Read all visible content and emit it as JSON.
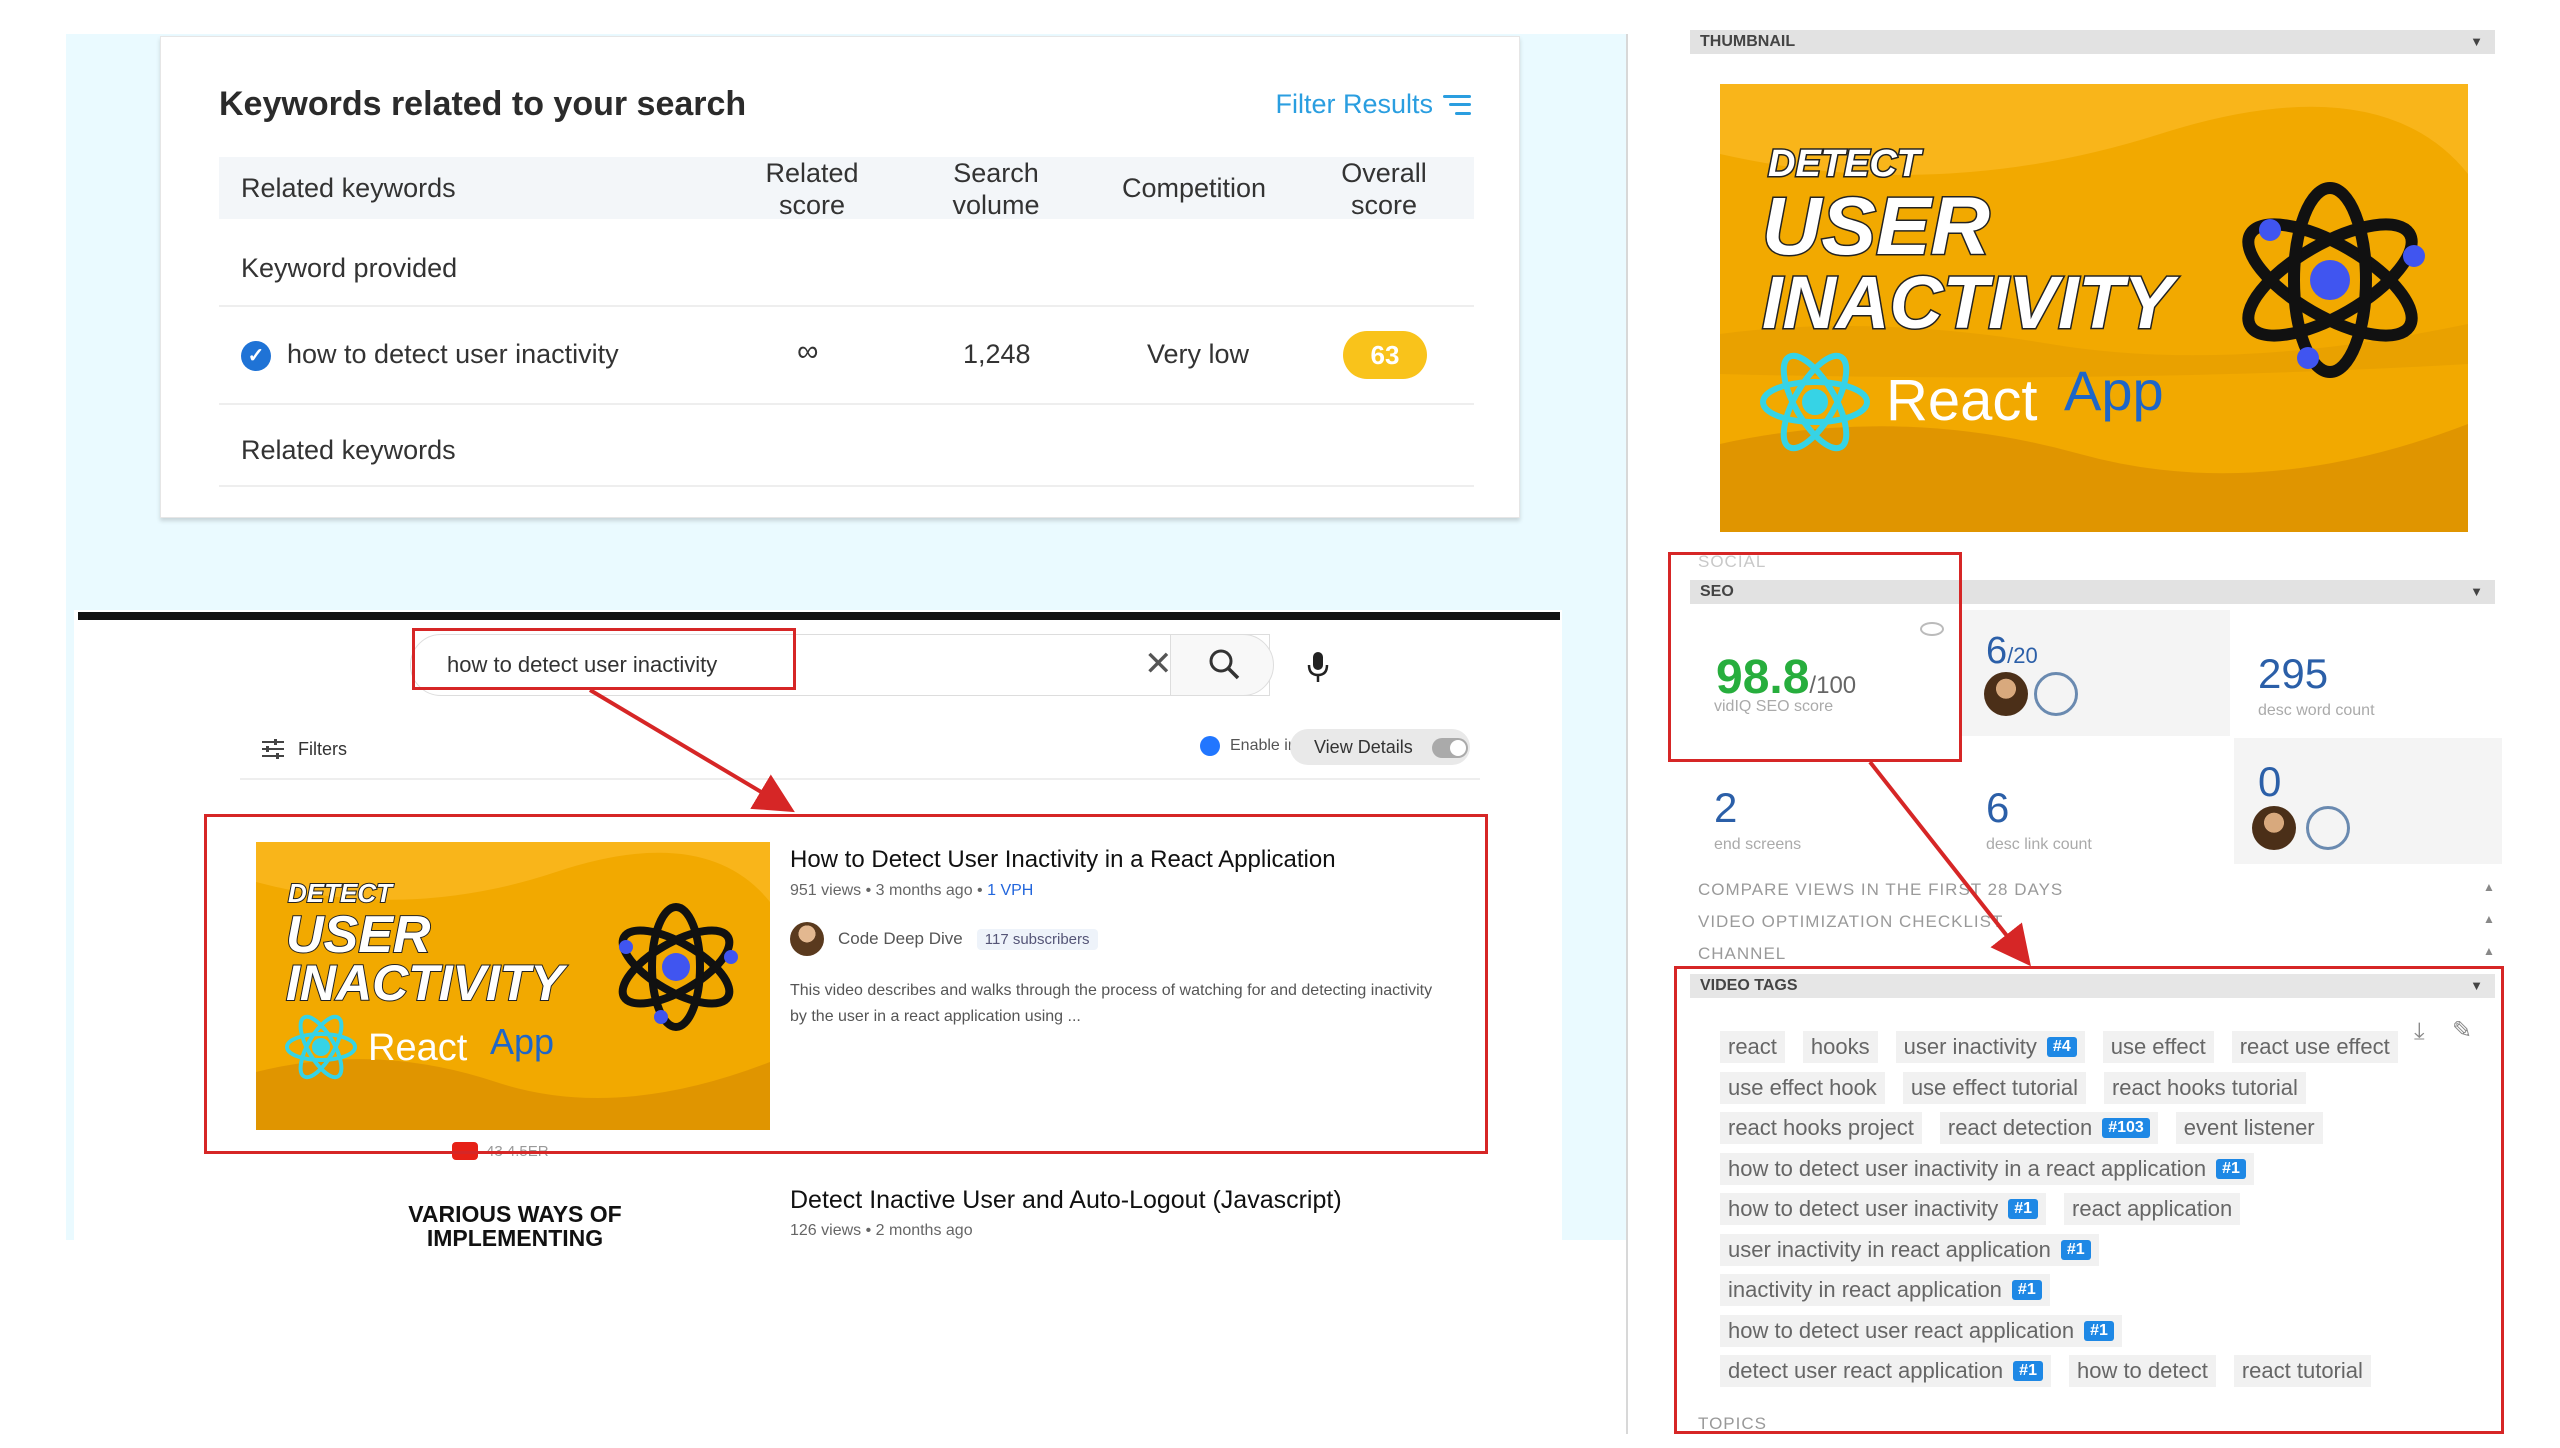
{
  "keywords": {
    "title": "Keywords related to your search",
    "filter_label": "Filter Results",
    "columns": [
      "Related keywords",
      "Related score",
      "Search volume",
      "Competition",
      "Overall score"
    ],
    "section_provided": "Keyword provided",
    "section_related": "Related keywords",
    "row": {
      "keyword": "how to detect user inactivity",
      "related_score": "∞",
      "search_volume": "1,248",
      "competition": "Very low",
      "overall_score": "63"
    }
  },
  "search": {
    "query": "how to detect user inactivity",
    "filters_label": "Filters",
    "enable_label": "Enable in",
    "view_details_label": "View Details",
    "results": [
      {
        "title": "How to Detect User Inactivity in a React Application",
        "views": "951 views • 3 months ago •",
        "vph": "1 VPH",
        "channel": "Code Deep Dive",
        "subscribers": "117 subscribers",
        "description": "This video describes and walks through the process of watching for and detecting inactivity by the user in a react application using ..."
      },
      {
        "title": "Detect Inactive User and Auto-Logout (Javascript)",
        "views": "126 views • 2 months ago",
        "thumb_text": "VARIOUS WAYS OF IMPLEMENTING"
      }
    ],
    "mini_stats": "43  4.5ER"
  },
  "thumbnail": {
    "line1": "DETECT",
    "line2": "USER",
    "line3": "INACTIVITY",
    "react": "React",
    "app": "App"
  },
  "sidebar": {
    "thumbnail_label": "THUMBNAIL",
    "social_label": "SOCIAL",
    "seo_label": "SEO",
    "seo": {
      "score": "98.8",
      "score_max": "/100",
      "score_label": "vidIQ SEO score",
      "tags_ratio": "6",
      "tags_ratio_max": "/20",
      "desc_word_count": "295",
      "desc_word_count_label": "desc word count",
      "end_screens": "2",
      "end_screens_label": "end screens",
      "desc_link_count": "6",
      "desc_link_count_label": "desc link count",
      "cards": "0"
    },
    "collapsed": [
      "COMPARE VIEWS IN THE FIRST 28 DAYS",
      "VIDEO OPTIMIZATION CHECKLIST",
      "CHANNEL"
    ],
    "video_tags_label": "VIDEO TAGS",
    "topics_label": "TOPICS",
    "tag_rows": [
      [
        {
          "t": "react"
        },
        {
          "t": "hooks"
        },
        {
          "t": "user inactivity",
          "r": "#4"
        },
        {
          "t": "use effect"
        },
        {
          "t": "react use effect"
        }
      ],
      [
        {
          "t": "use effect hook"
        },
        {
          "t": "use effect tutorial"
        },
        {
          "t": "react hooks tutorial"
        }
      ],
      [
        {
          "t": "react hooks project"
        },
        {
          "t": "react detection",
          "r": "#103"
        },
        {
          "t": "event listener"
        }
      ],
      [
        {
          "t": "how to detect user inactivity in a react application",
          "r": "#1"
        }
      ],
      [
        {
          "t": "how to detect user inactivity",
          "r": "#1"
        },
        {
          "t": "react application"
        }
      ],
      [
        {
          "t": "user inactivity in react application",
          "r": "#1"
        }
      ],
      [
        {
          "t": "inactivity in react application",
          "r": "#1"
        }
      ],
      [
        {
          "t": "how to detect user react application",
          "r": "#1"
        }
      ],
      [
        {
          "t": "detect user react application",
          "r": "#1"
        },
        {
          "t": "how to detect"
        },
        {
          "t": "react tutorial"
        }
      ]
    ]
  },
  "colors": {
    "accent_blue": "#2a9ee0",
    "highlight_red": "#d62626",
    "score_yellow": "#f9c31b",
    "thumb_orange": "#f2a900",
    "seo_green": "#27ae3d"
  }
}
